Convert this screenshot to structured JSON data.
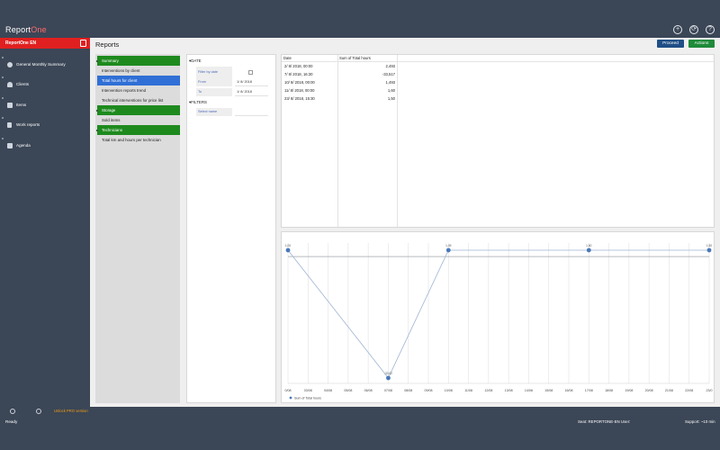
{
  "app": {
    "logo_main": "Report",
    "logo_accent": "One"
  },
  "top_icons": [
    {
      "name": "add-circle-icon",
      "glyph": "+"
    },
    {
      "name": "sync-icon",
      "glyph": "⟳"
    },
    {
      "name": "help-icon",
      "glyph": "?"
    }
  ],
  "sidebar": {
    "header": "ReportOne EN",
    "items": [
      {
        "label": "General Monthly Summary",
        "icon": "globe-icon"
      },
      {
        "label": "Clients",
        "icon": "person-icon"
      },
      {
        "label": "Items",
        "icon": "box-icon"
      },
      {
        "label": "Work reports",
        "icon": "document-icon"
      },
      {
        "label": "Agenda",
        "icon": "calendar-icon"
      }
    ]
  },
  "main": {
    "title": "Reports",
    "proceed_label": "Proceed",
    "actions_label": "Actions"
  },
  "report_list": [
    {
      "label": "Summary",
      "kind": "group"
    },
    {
      "label": "Interventions by client",
      "kind": "item"
    },
    {
      "label": "Total hours for client",
      "kind": "selected"
    },
    {
      "label": "Intervention reports trend",
      "kind": "item"
    },
    {
      "label": "Technical interventions for price list",
      "kind": "item"
    },
    {
      "label": "Storage",
      "kind": "group"
    },
    {
      "label": "Sold items",
      "kind": "item"
    },
    {
      "label": "Technicians",
      "kind": "group"
    },
    {
      "label": "Total km and hours per technician",
      "kind": "item"
    }
  ],
  "filters": {
    "date_section": "DATE",
    "filter_by_date_label": "Filter by date",
    "from_label": "From",
    "from_value": "1/ 8/ 2018",
    "to_label": "To",
    "to_value": "1/ 8/ 2018",
    "filters_section": "FILTERS",
    "select_name_label": "Select name"
  },
  "table": {
    "headers": [
      "Date",
      "Sum of Total hours"
    ],
    "rows": [
      {
        "date": "2/ 8/ 2018, 00:00",
        "value": "2,493"
      },
      {
        "date": "7/ 8/ 2018, 16:30",
        "value": "-33,517"
      },
      {
        "date": "10/ 8/ 2018, 00:00",
        "value": "1,493"
      },
      {
        "date": "11/ 8/ 2018, 00:00",
        "value": "1,60"
      },
      {
        "date": "23/ 8/ 2018, 15:30",
        "value": "1,50"
      }
    ]
  },
  "chart_data": {
    "type": "line",
    "x_ticks": [
      "0/08",
      "03/08",
      "04/08",
      "05/08",
      "06/08",
      "07/08",
      "08/08",
      "09/08",
      "10/08",
      "11/08",
      "12/08",
      "13/08",
      "14/08",
      "15/08",
      "16/08",
      "17/08",
      "18/08",
      "19/08",
      "20/08",
      "21/08",
      "22/08",
      "23/0"
    ],
    "points": [
      {
        "x_index": 0,
        "y": 1.0,
        "label": "1,00"
      },
      {
        "x_index": 5,
        "y": -1.0,
        "label": "-33,52"
      },
      {
        "x_index": 8,
        "y": 1.0,
        "label": "1,49"
      },
      {
        "x_index": 15,
        "y": 1.0,
        "label": "1,60"
      },
      {
        "x_index": 21,
        "y": 1.0,
        "label": "1,50"
      }
    ],
    "series_name": "Sum of Total hours",
    "ylim": [
      -1.0,
      1.0
    ],
    "grid": true,
    "legend": "bottom-left"
  },
  "bottom": {
    "unlock_label": "Unlock PRO version"
  },
  "status": {
    "left": "Ready",
    "seat": "Seat: REPORTONE-EN  User:",
    "support": "Support: ~10 min"
  },
  "colors": {
    "accent_red": "#e02020",
    "group_green": "#1e8a1e",
    "selected_blue": "#2f6fd6",
    "proceed_blue": "#1f4f86",
    "actions_green": "#1e8a3a",
    "point_blue": "#4a78b8"
  }
}
